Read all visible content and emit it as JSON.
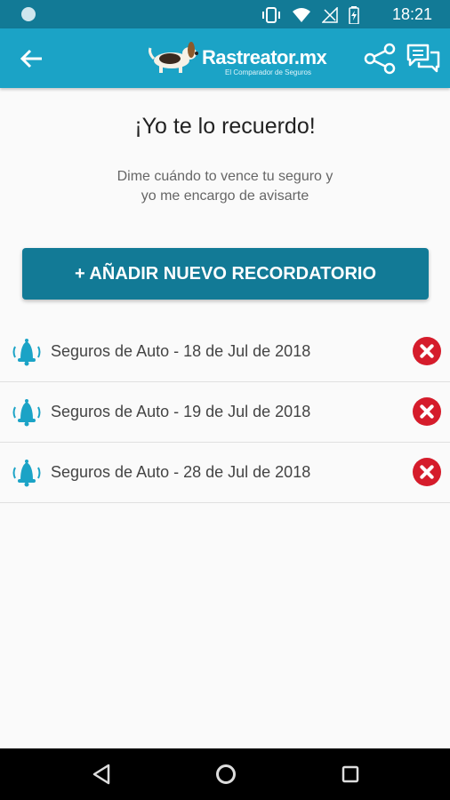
{
  "status_bar": {
    "time": "18:21",
    "icons": [
      "vibrate-icon",
      "wifi-icon",
      "no-signal-icon",
      "battery-charging-icon"
    ]
  },
  "app_bar": {
    "logo_text": "Rastreator.mx",
    "logo_tagline": "El Comparador de Seguros",
    "icons": [
      "back-arrow-icon",
      "share-icon",
      "chat-icon"
    ],
    "colors": {
      "primary": "#1ba3c6",
      "dark": "#127a96"
    }
  },
  "main": {
    "title": "¡Yo te lo recuerdo!",
    "subtitle_line1": "Dime cuándo to vence tu seguro y",
    "subtitle_line2": "yo me encargo de avisarte",
    "add_button_label": "+ AÑADIR NUEVO RECORDATORIO"
  },
  "reminders": [
    {
      "label": "Seguros de Auto - 18 de Jul de 2018",
      "icon": "bell-icon",
      "delete_icon": "delete-icon"
    },
    {
      "label": "Seguros de Auto - 19 de Jul de 2018",
      "icon": "bell-icon",
      "delete_icon": "delete-icon"
    },
    {
      "label": "Seguros de Auto - 28 de Jul de 2018",
      "icon": "bell-icon",
      "delete_icon": "delete-icon"
    }
  ],
  "colors": {
    "delete": "#d51c2b",
    "bell": "#1ba3c6"
  },
  "nav_bar": {
    "icons": [
      "nav-back-icon",
      "nav-home-icon",
      "nav-recents-icon"
    ]
  }
}
